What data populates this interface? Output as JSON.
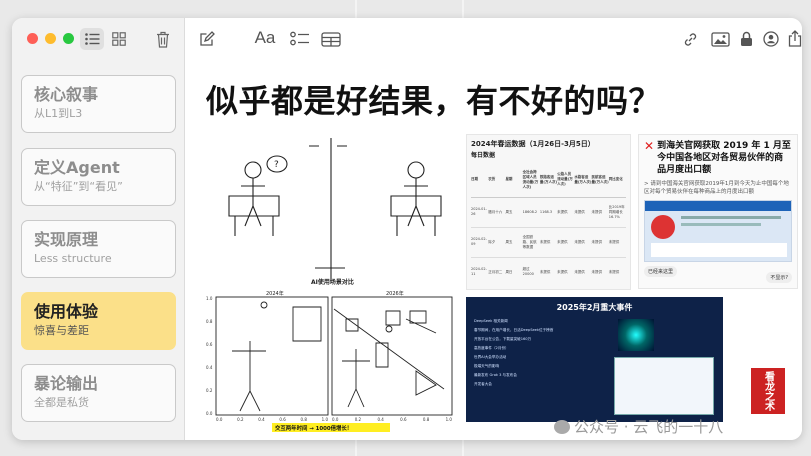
{
  "toolbar": {
    "traffic_lights": [
      "#fe5f57",
      "#febc2e",
      "#28c840"
    ],
    "list_view_icon": "list-icon",
    "grid_view_icon": "grid-icon",
    "trash_icon": "trash-icon",
    "compose_icon": "compose-icon",
    "format_label": "Aa",
    "checklist_icon": "checklist-icon",
    "table_icon": "table-icon",
    "link_icon": "link-icon",
    "media_icon": "photo-icon",
    "lock_icon": "lock-icon",
    "collab_icon": "person-icon",
    "share_icon": "share-icon"
  },
  "sidebar": {
    "items": [
      {
        "title": "核心叙事",
        "subtitle": "从L1到L3",
        "selected": false
      },
      {
        "title": "定义Agent",
        "subtitle": "从“特征”到“看见”",
        "selected": false
      },
      {
        "title": "实现原理",
        "subtitle": "Less structure",
        "selected": false
      },
      {
        "title": "使用体验",
        "subtitle": "惊喜与差距",
        "selected": true
      },
      {
        "title": "暴论输出",
        "subtitle": "全都是私货",
        "selected": false
      }
    ]
  },
  "slide": {
    "title": "似乎都是好结果，有不好的吗？",
    "stick_figure": {
      "caption": "AI使用场景对比",
      "bubble_left": "?",
      "bubble_right": ""
    },
    "plot": {
      "left_title": "2024年",
      "right_title": "2026年",
      "caption": "交互两年时间 → 1000倍增长！",
      "left_yticks": [
        "1.0",
        "0.8",
        "0.6",
        "0.4",
        "0.2",
        "0.0"
      ],
      "left_xticks": [
        "0.0",
        "0.2",
        "0.4",
        "0.6",
        "0.8",
        "1.0"
      ],
      "right_xticks": [
        "0.0",
        "0.2",
        "0.4",
        "0.6",
        "0.8",
        "1.0"
      ]
    },
    "table_doc": {
      "heading": "2024年春运数据（1月26日-3月5日）",
      "subheading": "每日数据",
      "columns": [
        "日期",
        "农历",
        "星期",
        "全社会跨区域人员流动量(万人次)",
        "铁路客运量(万人次)",
        "公路人员流动量(万人次)",
        "水路客运量(万人次)",
        "民航客运量(万人次)",
        "同比变化"
      ],
      "rows": [
        [
          "2024-01-26",
          "腊月十六",
          "周五",
          "18608.2",
          "1168.3",
          "未提供",
          "未提供",
          "未提供",
          "比2019年同期增长16.7%"
        ],
        [
          "2024-02-09",
          "除夕",
          "周五",
          "全国铁路、民航等数据",
          "未提供",
          "未提供",
          "未提供",
          "未提供",
          "未提供"
        ],
        [
          "2024-02-11",
          "正月初二",
          "周日",
          "超过20000",
          "未提供",
          "未提供",
          "未提供",
          "未提供",
          "未提供"
        ]
      ]
    },
    "customs_doc": {
      "heading": "到海关官网获取 2019 年 1 月至今中国各地区对各贸易伙伴的商品月度出口额",
      "description": "> 请到中国海关官网获取2019年1月到今天为止中国每个地区对每个贸易伙伴在每种商品上的月度出口额",
      "status_left": "已经来这里",
      "status_right": "不显示?"
    },
    "event_doc": {
      "heading": "2025年2月重大事件",
      "bullets": [
        "DeepSeek 相关新闻",
        "春节期间，在用户增长，日活DeepSeek位于榜首",
        "开放平台在公告，下载量突破160万",
        "高热度事件（2月份）",
        "世界AI大会举办活动",
        "极端天气的影响",
        "最新发布 Grok 3 与发布会",
        "开发者大会"
      ]
    },
    "watermark": "公众号 · 云飞的一十八",
    "stamp": "看龙之术"
  }
}
